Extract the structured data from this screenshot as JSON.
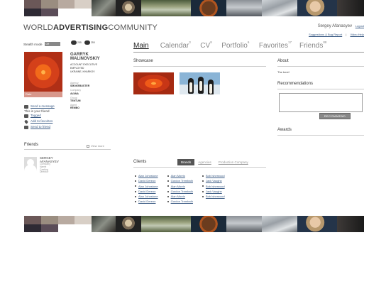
{
  "header": {
    "logo_pre": "WORLD",
    "logo_bold": "ADVERTISING",
    "logo_post": "COMMUNITY",
    "user_name": "Sergey Afanasyev",
    "logout": "Logout",
    "link_suggestions": "Suggestions & Bug Report",
    "link_sep": "|",
    "link_help": "Video Help"
  },
  "left": {
    "stealth_label": "Stealth mode",
    "stealth_value": "Off",
    "counter1": "255",
    "counter2": "255",
    "rate_label": "Rate",
    "profile_name_1": "GARRYK",
    "profile_name_2": "MALINOVSKIY",
    "position": "ACCOUNT EXECUTIVE",
    "status": "EMPLOYED",
    "location": "UKRAINE, KHARKOV",
    "facts": [
      {
        "k": "Agency",
        "v": "SMOKEBUSTER"
      },
      {
        "k": "Company",
        "v": "AVANA"
      },
      {
        "k": "Group",
        "v": "TENTUM"
      },
      {
        "k": "Agent",
        "v": "RЕМВО"
      }
    ],
    "actions": {
      "send_message": "Send a message",
      "is_friend": "This is your friend",
      "tagged": "Tagged",
      "add_favorites": "Add to favorites",
      "send_friend": "Send to friend"
    },
    "friends_title": "Friends",
    "view_more": "View more",
    "friend": {
      "name_1": "SERGEY",
      "name_2": "AFANASYEV",
      "sub_1": "Company",
      "sub_2": "Name",
      "sub_3": "Casting",
      "sub_4": "Director"
    }
  },
  "nav": {
    "items": [
      {
        "label": "Main",
        "badge": ""
      },
      {
        "label": "Calendar",
        "badge": "3"
      },
      {
        "label": "CV",
        "badge": "8"
      },
      {
        "label": "Portfolio",
        "badge": "6"
      },
      {
        "label": "Favorites",
        "badge": "17"
      },
      {
        "label": "Friends",
        "badge": "88"
      }
    ]
  },
  "showcase_title": "Showcase",
  "clients": {
    "title": "Clients",
    "tabs": [
      "Brands",
      "Agencies",
      "Production Company"
    ],
    "col1": [
      "Alan Johnstone",
      "David Dereon",
      "Alan Johnstone",
      "David Dereon",
      "Alan Johnstone",
      "David Dereon"
    ],
    "col2": [
      "Alan Morris",
      "Gordon Trembath",
      "Alan Morris",
      "Gordon Trembath",
      "Alan Morris",
      "Gordon Trembath"
    ],
    "col3": [
      "Bob Isherwood",
      "Jack Vaughn",
      "Bob Isherwood",
      "Jack Vaughn",
      "Bob Isherwood"
    ]
  },
  "right": {
    "about_title": "About",
    "about_text": "The best!",
    "rec_title": "Recommendations",
    "rec_placeholder": "",
    "rec_button": "RECOMMEND",
    "awards_title": "Awards"
  }
}
